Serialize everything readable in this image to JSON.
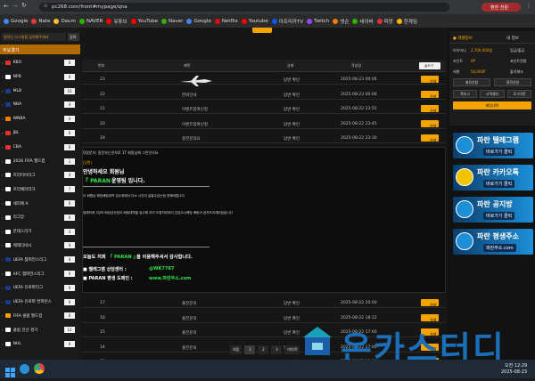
{
  "browser": {
    "url": "pc268.com/front#mypage/qna",
    "profile_label": "환한 천원",
    "bookmarks": [
      "Google",
      "Nate",
      "Daum",
      "NAVER",
      "유튜브",
      "YouTube",
      "Naver",
      "Google",
      "Netflix",
      "Youtube",
      "아프리카TV",
      "Twitch",
      "넷슨",
      "네이버",
      "피망",
      "한게임"
    ]
  },
  "sidebar": {
    "search_placeholder": "원하는 리그명을 입력해주세요",
    "search_button": "검색",
    "section_title": "주요경기",
    "items": [
      {
        "label": "KBO",
        "count": "0"
      },
      {
        "label": "NPB",
        "count": "0"
      },
      {
        "label": "MLB",
        "count": "10"
      },
      {
        "label": "NBA",
        "count": "4"
      },
      {
        "label": "WNBA",
        "count": "4"
      },
      {
        "label": "JBL",
        "count": "0"
      },
      {
        "label": "CBA",
        "count": "0"
      },
      {
        "label": "2026 FIFA 월드컵",
        "count": "1"
      },
      {
        "label": "프리미어리그",
        "count": "4"
      },
      {
        "label": "프리메라리가",
        "count": "7"
      },
      {
        "label": "세리에 A",
        "count": "0"
      },
      {
        "label": "리그앙",
        "count": "0"
      },
      {
        "label": "분데스리가",
        "count": "3"
      },
      {
        "label": "에레디비시",
        "count": "4"
      },
      {
        "label": "UEFA 챔피언스리그",
        "count": "4"
      },
      {
        "label": "AFC 챔피언스리그",
        "count": "0"
      },
      {
        "label": "UEFA 유로파리그",
        "count": "0"
      },
      {
        "label": "UEFA 유로파 컨퍼런스",
        "count": "0"
      },
      {
        "label": "FIFA 클럽 월드컵",
        "count": "0"
      },
      {
        "label": "클럽 친선 경기",
        "count": "12"
      },
      {
        "label": "NHL",
        "count": "0"
      }
    ]
  },
  "table": {
    "tab_label": "",
    "write_button": "글쓰기",
    "headers": [
      "번호",
      "제목",
      "상태",
      "작성일"
    ],
    "top_rows": [
      {
        "no": "23",
        "title": "",
        "status": "답변 확인",
        "date": "2025-08-23 00:06",
        "btn": "삭제"
      },
      {
        "no": "22",
        "title": "연락안내",
        "status": "답변 확인",
        "date": "2025-08-23 00:06",
        "btn": "삭제"
      },
      {
        "no": "21",
        "title": "이벤트참여신청",
        "status": "답변 확인",
        "date": "2025-08-22 23:55",
        "btn": "삭제"
      },
      {
        "no": "20",
        "title": "이벤트참여신청",
        "status": "답변 확인",
        "date": "2025-08-22 23:45",
        "btn": "삭제"
      },
      {
        "no": "19",
        "title": "충전문의요",
        "status": "답변 확인",
        "date": "2025-08-22 23:30",
        "btn": "삭제"
      }
    ],
    "bottom_rows": [
      {
        "no": "17",
        "title": "출전문의",
        "status": "답변 확인",
        "date": "2025-08-22 20:00",
        "btn": "삭제"
      },
      {
        "no": "16",
        "title": "출전문의",
        "status": "답변 확인",
        "date": "2025-08-22 18:12",
        "btn": "삭제"
      },
      {
        "no": "15",
        "title": "출전문의",
        "status": "답변 확인",
        "date": "2025-08-22 17:00",
        "btn": "삭제"
      },
      {
        "no": "14",
        "title": "출전문의",
        "status": "답변 확인",
        "date": "2025-08-22 17:00",
        "btn": "삭제"
      },
      {
        "no": "13",
        "title": "출전문의",
        "status": "답변 확인",
        "date": "2025-08-22 16:00",
        "btn": "삭제"
      }
    ]
  },
  "message": {
    "question": "Q질문자: 질문자는전자로 1T 회원님께 그린인가요",
    "answer_tag": "[답변]",
    "greeting": "안녕하세요 회원님",
    "brand_line_pre": "『 PARAN 』",
    "brand_line_post": "운영팀 입니다.",
    "body1": "이 회원님 해당배팅내역 검수위해서 다소 시간이 길될수있는점 양해바랍니다",
    "body2": "정해하게 2장의 배당금산정이 배팅내역을 검수해 이미 오정처리되어 있었으나해당 배팅이 공지드리게되었습니다",
    "thanks_pre": "오늘도 저희",
    "thanks_brand": "『 PARAN 』",
    "thanks_post": "을 이용해주셔서 감사합니다.",
    "telegram_label": "■ 텔레그램 상담센터 :",
    "telegram_id": "@WK7787",
    "domain_label": "■ PARAN 평생 도메인 :",
    "domain_value": "www.파란주소.com"
  },
  "pagination": {
    "items": [
      "처음",
      "1",
      "2",
      "3",
      "마지막"
    ]
  },
  "right_panel": {
    "title": "내 정보",
    "id_label": "보유머니",
    "money_value": "2,700,000원",
    "charge_label": "입금/출금",
    "point_label": "포인트",
    "point_value": "0P",
    "point_action": "포인트전환",
    "level_label": "레벨",
    "level_value": "50,000P",
    "level_action": "출석체크",
    "btn_charge": "충전신청",
    "btn_withdraw": "환전신청",
    "btn_msg": "쪽지 0",
    "btn_qna": "고객센터",
    "btn_logout": "로그아웃",
    "btn_bet": "배팅내역"
  },
  "banners": [
    {
      "title": "파란 텔레그램",
      "sub": "바로가기 클릭",
      "color": "#1d8fd8"
    },
    {
      "title": "파란 카카오톡",
      "sub": "바로가기 클릭",
      "color": "#1d8fd8"
    },
    {
      "title": "파란 공지방",
      "sub": "바로가기 클릭",
      "color": "#1d8fd8"
    },
    {
      "title": "파란 평생주소",
      "sub": "파란주소.com",
      "color": "#1d8fd8"
    }
  ],
  "watermark": "온카스터디",
  "taskbar": {
    "time": "오전 12:29",
    "date": "2025-08-23"
  },
  "colors": {
    "accent": "#f4a300",
    "green": "#31e04a",
    "banner_blue": "#1d8fd8"
  }
}
